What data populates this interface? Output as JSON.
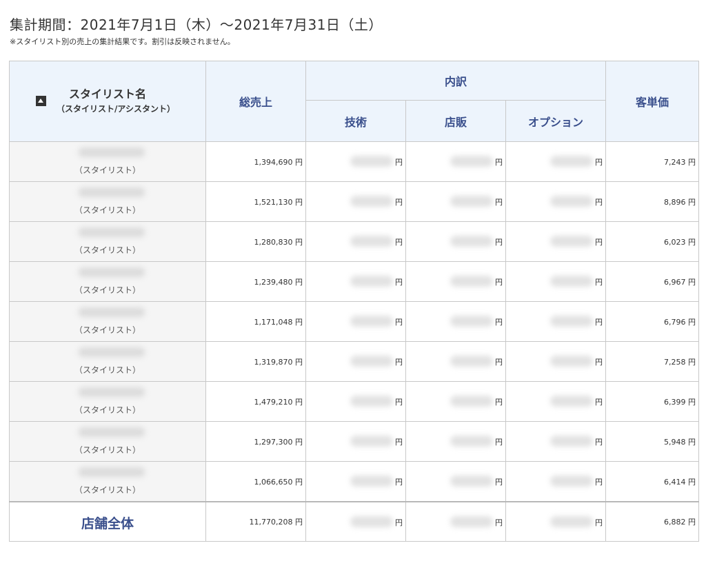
{
  "header": {
    "period": "集計期間：2021年7月1日（木）〜2021年7月31日（土）",
    "note": "※スタイリスト別の売上の集計結果です。割引は反映されません。"
  },
  "table": {
    "columns": {
      "stylist_title": "スタイリスト名",
      "stylist_sub": "（スタイリスト/アシスタント）",
      "total": "総売上",
      "breakdown": "内訳",
      "technique": "技術",
      "retail": "店販",
      "option": "オプション",
      "per_customer": "客単価"
    },
    "rows": [
      {
        "role": "（スタイリスト）",
        "total": "1,394,690 円",
        "per_customer": "7,243 円"
      },
      {
        "role": "（スタイリスト）",
        "total": "1,521,130 円",
        "per_customer": "8,896 円"
      },
      {
        "role": "（スタイリスト）",
        "total": "1,280,830 円",
        "per_customer": "6,023 円"
      },
      {
        "role": "（スタイリスト）",
        "total": "1,239,480 円",
        "per_customer": "6,967 円"
      },
      {
        "role": "（スタイリスト）",
        "total": "1,171,048 円",
        "per_customer": "6,796 円"
      },
      {
        "role": "（スタイリスト）",
        "total": "1,319,870 円",
        "per_customer": "7,258 円"
      },
      {
        "role": "（スタイリスト）",
        "total": "1,479,210 円",
        "per_customer": "6,399 円"
      },
      {
        "role": "（スタイリスト）",
        "total": "1,297,300 円",
        "per_customer": "5,948 円"
      },
      {
        "role": "（スタイリスト）",
        "total": "1,066,650 円",
        "per_customer": "6,414 円"
      }
    ],
    "summary": {
      "label": "店舗全体",
      "total": "11,770,208 円",
      "per_customer": "6,882 円"
    },
    "yen": "円"
  }
}
